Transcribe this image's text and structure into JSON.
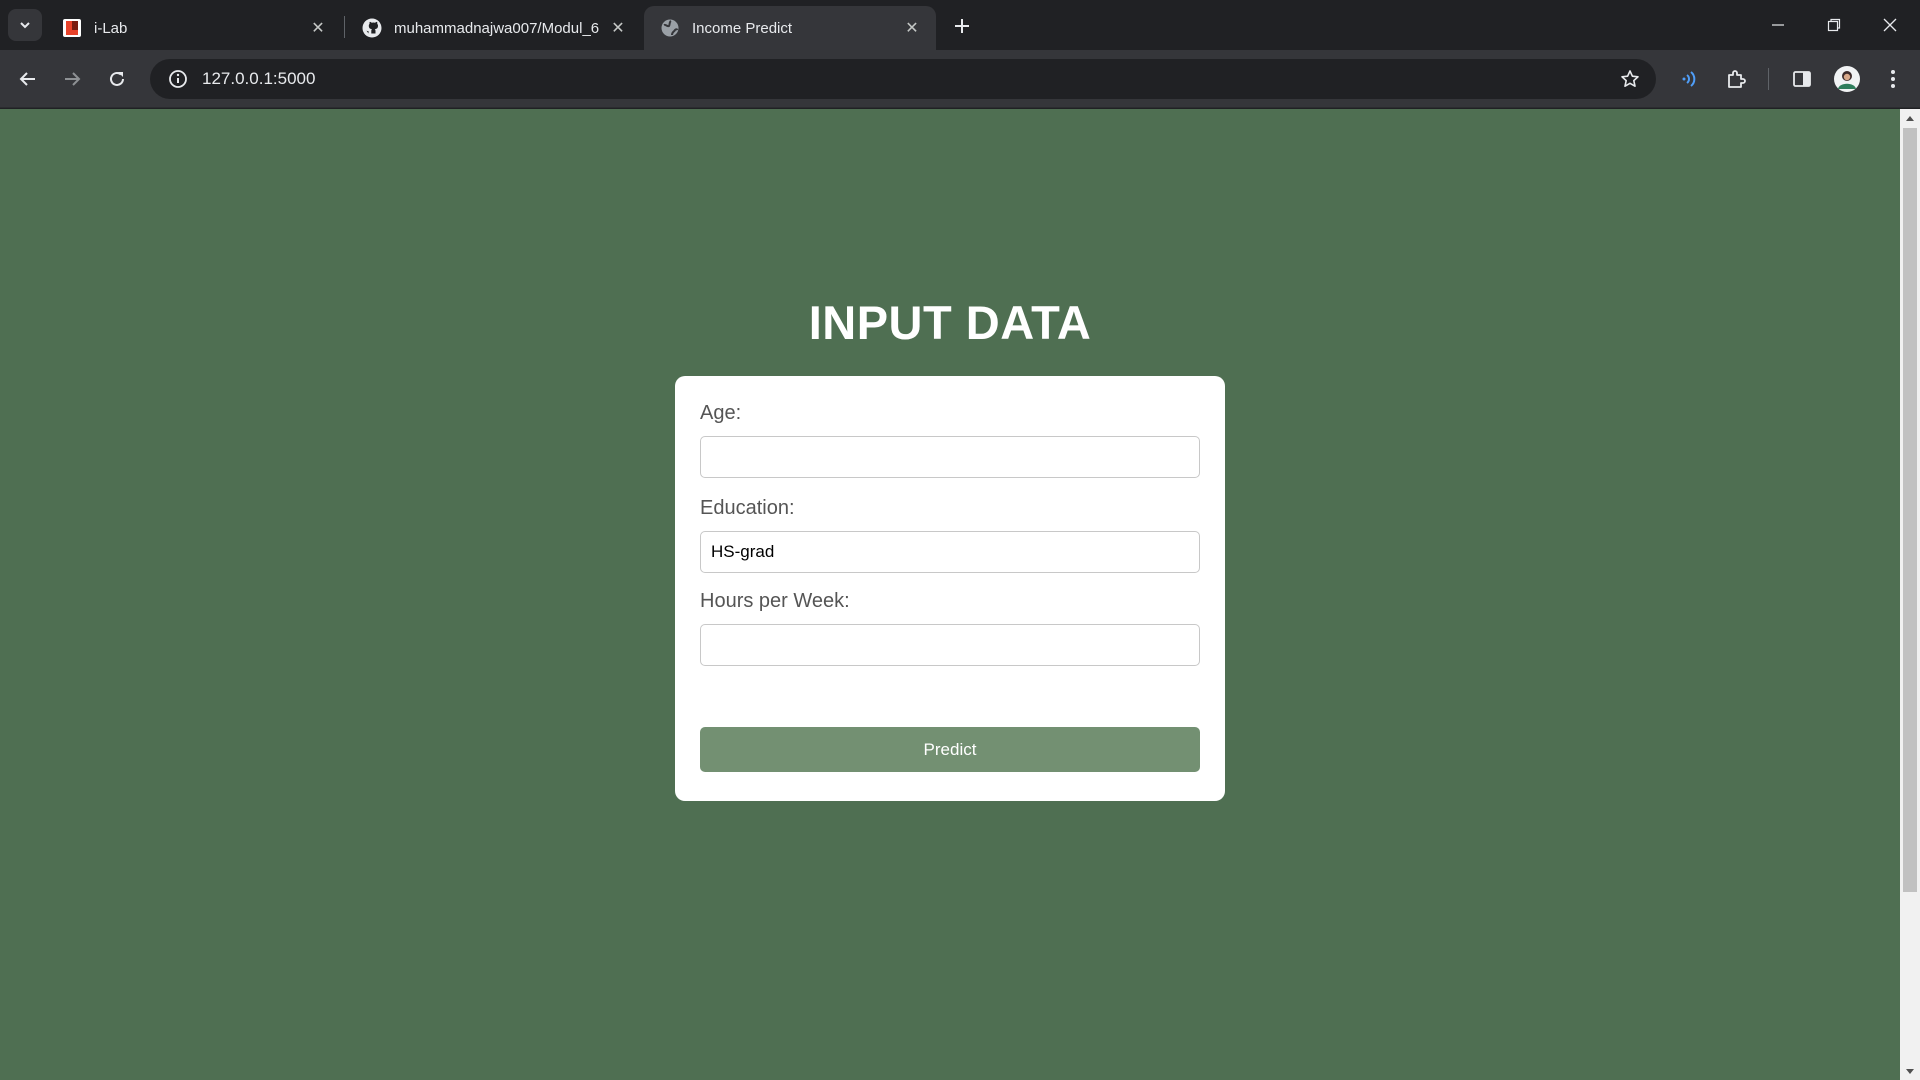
{
  "browser": {
    "tabs": [
      {
        "title": "i-Lab",
        "favicon": "ilab-logo-icon",
        "active": false
      },
      {
        "title": "muhammadnajwa007/Modul_6",
        "favicon": "github-icon",
        "active": false
      },
      {
        "title": "Income Predict",
        "favicon": "globe-icon",
        "active": true
      }
    ],
    "address_bar": {
      "url": "127.0.0.1:5000"
    }
  },
  "page": {
    "heading": "INPUT DATA",
    "form": {
      "age": {
        "label": "Age:",
        "value": ""
      },
      "education": {
        "label": "Education:",
        "value": "HS-grad"
      },
      "hours_per_week": {
        "label": "Hours per Week:",
        "value": ""
      },
      "submit_label": "Predict"
    }
  },
  "colors": {
    "page_background": "#4f6f52",
    "button_background": "#739072",
    "card_background": "#ffffff",
    "browser_frame": "#202124",
    "toolbar": "#35363a"
  }
}
